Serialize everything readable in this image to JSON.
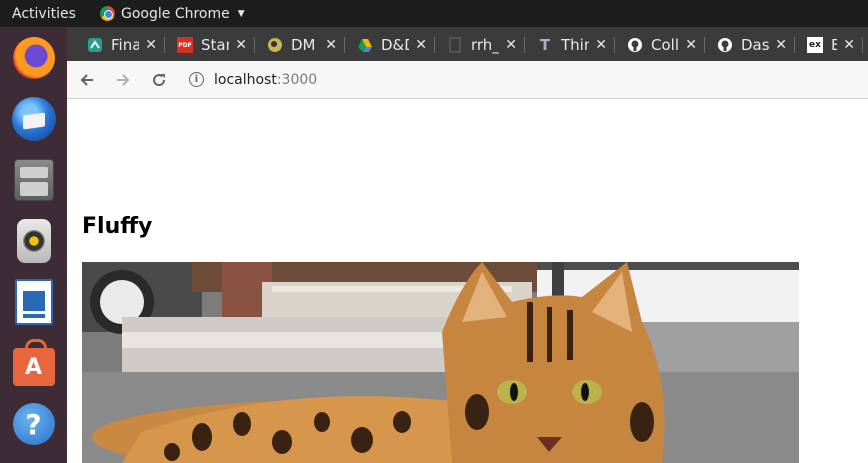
{
  "topbar": {
    "activities": "Activities",
    "app_name": "Google Chrome"
  },
  "dock": {
    "items": [
      {
        "name": "Firefox",
        "icon": "firefox-icon"
      },
      {
        "name": "Thunderbird",
        "icon": "thunderbird-icon"
      },
      {
        "name": "Files",
        "icon": "files-icon"
      },
      {
        "name": "Rhythmbox",
        "icon": "rhythmbox-icon"
      },
      {
        "name": "LibreOffice Writer",
        "icon": "libreoffice-writer-icon"
      },
      {
        "name": "Ubuntu Software",
        "icon": "software-icon"
      },
      {
        "name": "Help",
        "icon": "help-icon"
      }
    ],
    "help_glyph": "?",
    "software_glyph": "A"
  },
  "tabs": [
    {
      "title": "Fina",
      "favicon": "finance-icon",
      "color": "#2a9d8f"
    },
    {
      "title": "Star",
      "favicon": "pdf-icon",
      "color": "#d93025",
      "glyph": "PDF"
    },
    {
      "title": "DM",
      "favicon": "dm-icon",
      "color": "#c9b458"
    },
    {
      "title": "D&D",
      "favicon": "google-drive-icon",
      "color": "#f4b400"
    },
    {
      "title": "rrh_",
      "favicon": "document-icon",
      "color": "#6a6a6a"
    },
    {
      "title": "Thin",
      "favicon": "thin-icon",
      "color": "#9fb6c8",
      "glyph": "T"
    },
    {
      "title": "Coll",
      "favicon": "github-icon",
      "color": "#ffffff"
    },
    {
      "title": "Das",
      "favicon": "github-icon",
      "color": "#ffffff"
    },
    {
      "title": "Exp",
      "favicon": "ex-icon",
      "color": "#ffffff",
      "glyph": "ex"
    }
  ],
  "toolbar": {
    "host": "localhost",
    "port": ":3000"
  },
  "page": {
    "heading": "Fluffy",
    "image_alt": "Bengal cat lying on a doorstep"
  }
}
